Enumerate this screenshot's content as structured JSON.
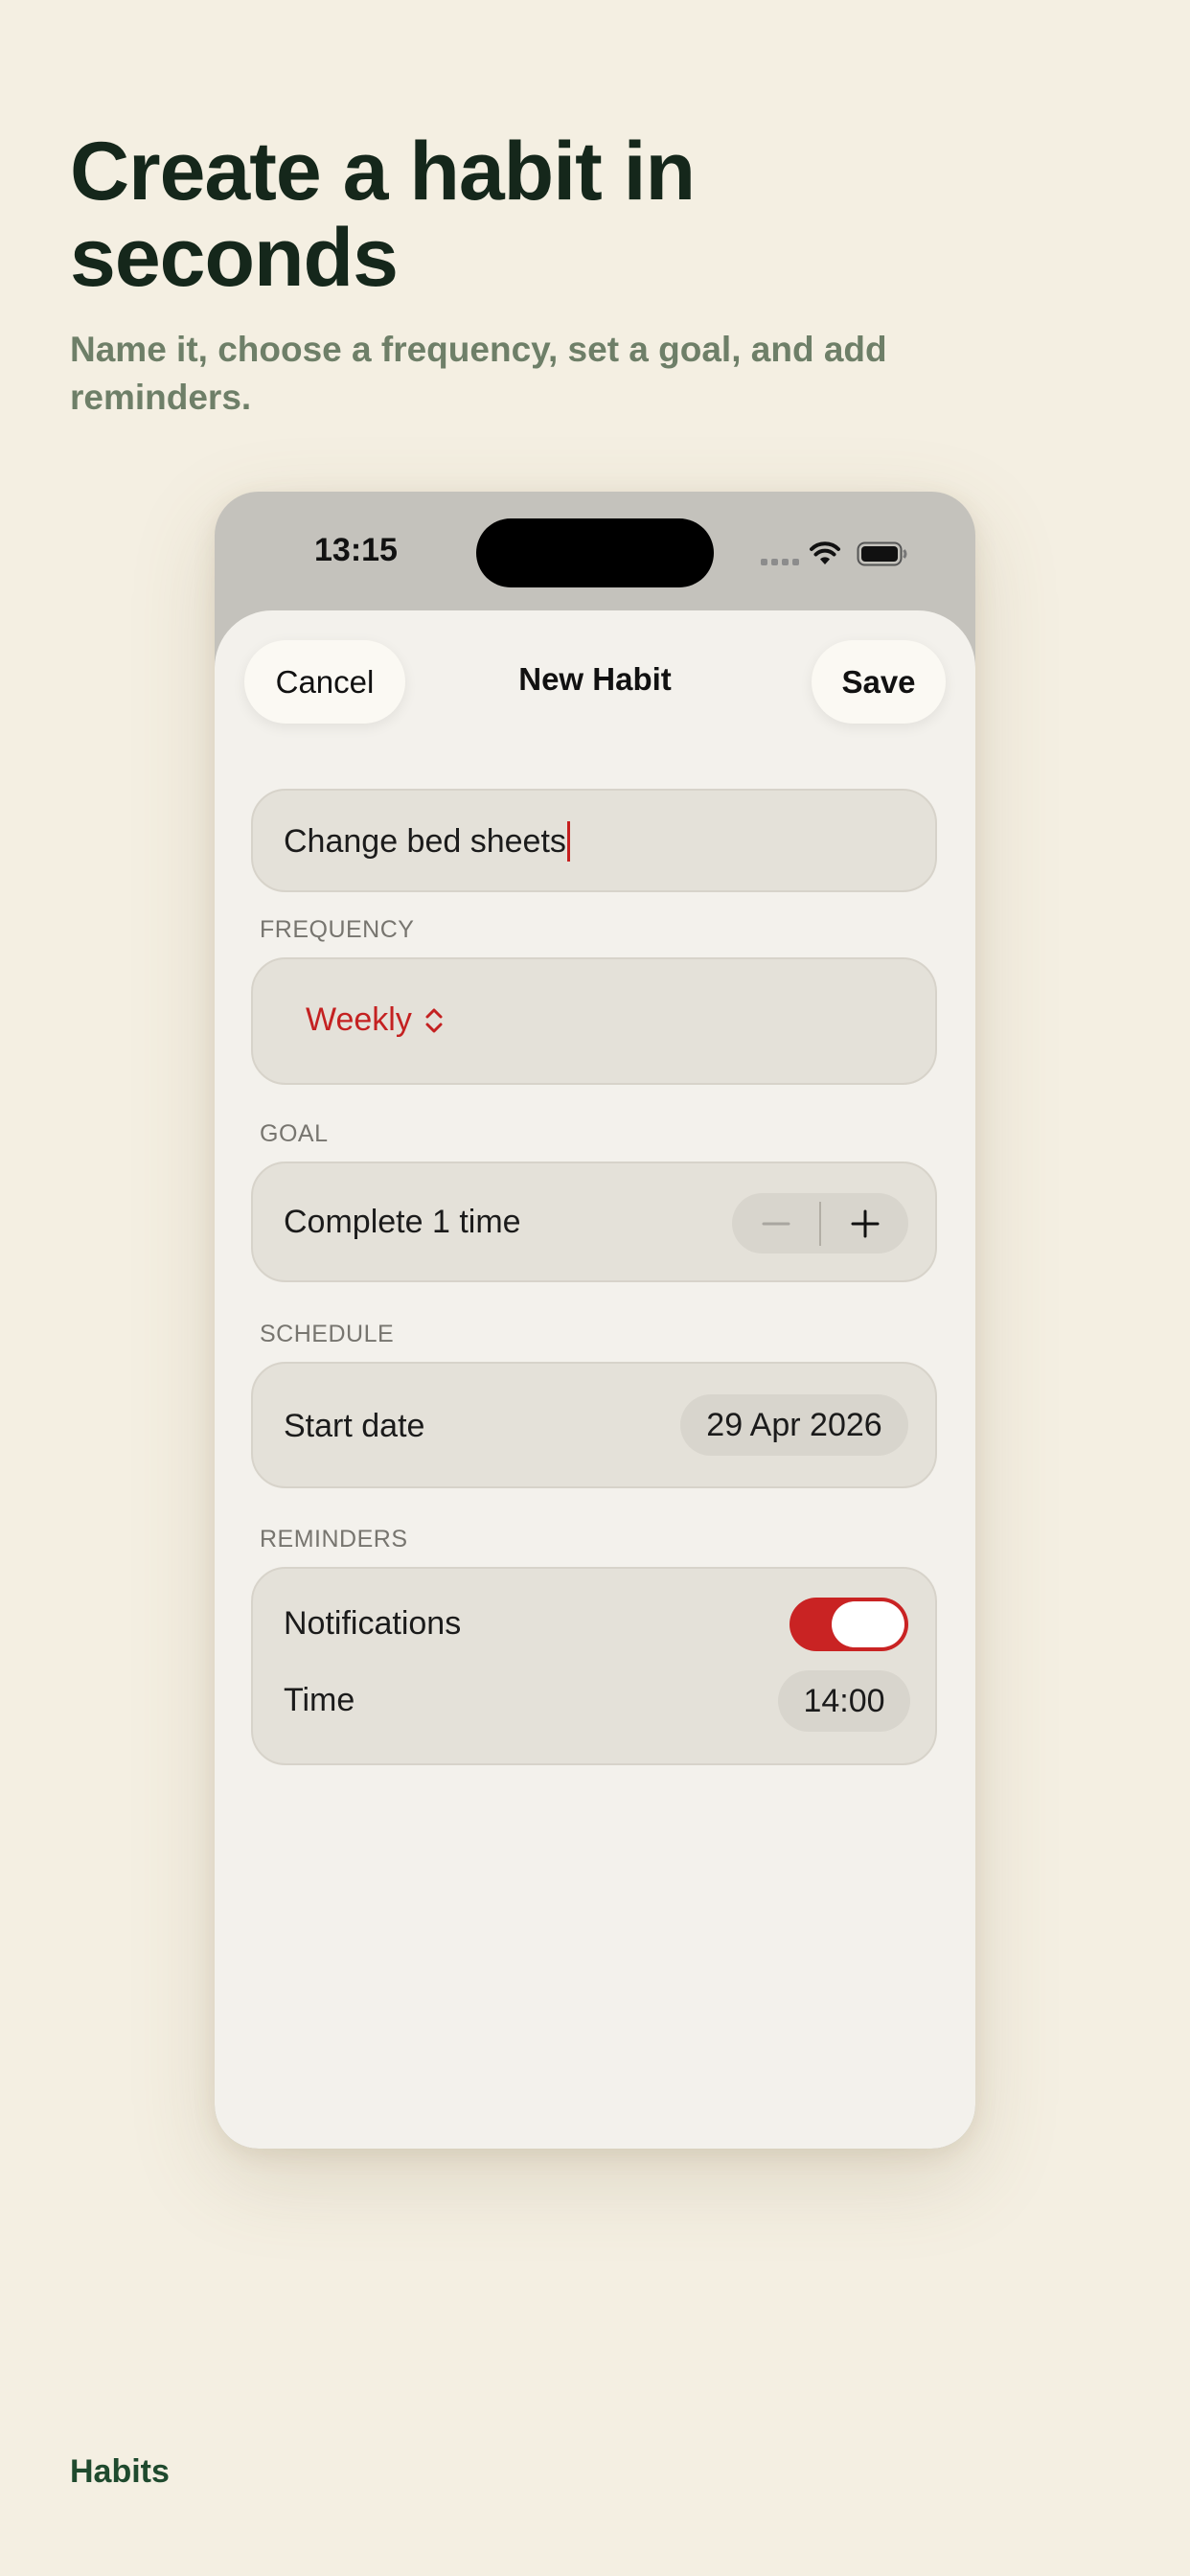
{
  "promo": {
    "headline": "Create a habit in seconds",
    "subheadline": "Name it, choose a frequency, set a goal, and add reminders.",
    "brand": "Habits"
  },
  "status_bar": {
    "time": "13:15",
    "icons": [
      "cellular-signal-icon",
      "wifi-icon",
      "battery-icon"
    ]
  },
  "nav": {
    "cancel_label": "Cancel",
    "title": "New Habit",
    "save_label": "Save"
  },
  "form": {
    "name_value": "Change bed sheets",
    "frequency": {
      "label": "FREQUENCY",
      "value": "Weekly",
      "icon": "chevron-up-down-icon"
    },
    "goal": {
      "label": "GOAL",
      "text": "Complete 1 time",
      "minus_icon": "minus-icon",
      "plus_icon": "plus-icon"
    },
    "schedule": {
      "label": "SCHEDULE",
      "start_date_label": "Start date",
      "start_date_value": "29 Apr 2026"
    },
    "reminders": {
      "label": "REMINDERS",
      "notifications_label": "Notifications",
      "notifications_on": true,
      "time_label": "Time",
      "time_value": "14:00"
    }
  },
  "colors": {
    "background": "#f4efe2",
    "headline": "#15271b",
    "subheadline": "#6e7f68",
    "brand": "#1f4a2e",
    "accent_red": "#c92323",
    "card": "#e4e1d9",
    "sheet": "#f3f1ec"
  }
}
